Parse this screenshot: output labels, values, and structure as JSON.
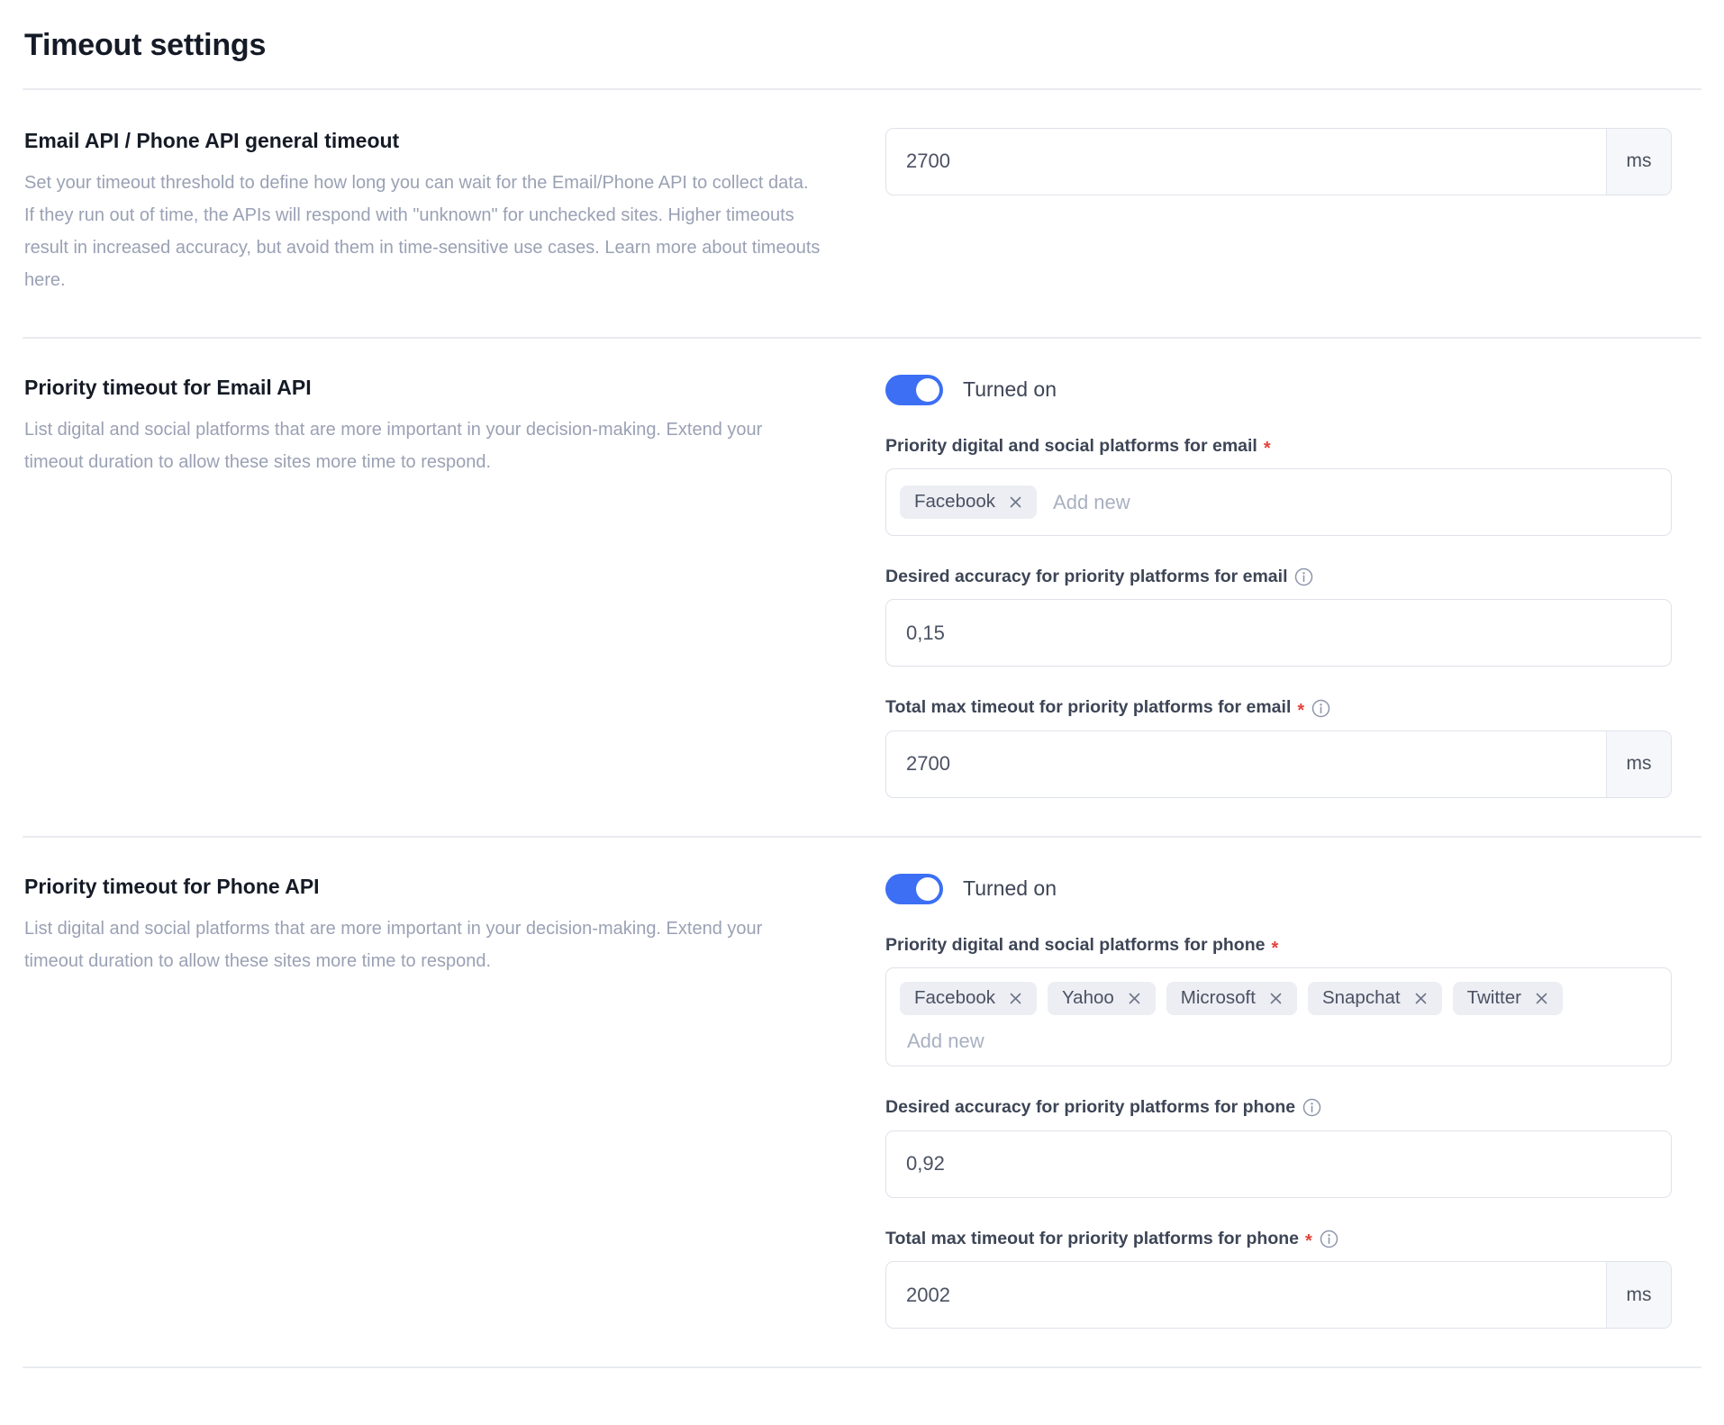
{
  "page": {
    "title": "Timeout settings"
  },
  "colors": {
    "toggle_on": "#3c6ff4",
    "required_star": "#e3443a",
    "text_primary": "#151b26",
    "text_muted": "#9aa1b4",
    "border": "#dfe2ea",
    "tag_bg": "#eceef3"
  },
  "sections": {
    "general": {
      "heading": "Email API / Phone API general timeout",
      "description": "Set your timeout threshold to define how long you can wait for the Email/Phone API to collect data. If they run out of time, the APIs will respond with \"unknown\" for unchecked sites. Higher timeouts result in increased accuracy, but avoid them in time-sensitive use cases. Learn more about timeouts here.",
      "timeout_value": "2700",
      "timeout_unit": "ms"
    },
    "email": {
      "heading": "Priority timeout for Email API",
      "description": "List digital and social platforms that are more important in your decision-making. Extend your timeout duration to allow these sites more time to respond.",
      "toggle_label": "Turned on",
      "toggle_state": "on",
      "platforms_label": "Priority digital and social platforms for email",
      "platforms_required": "*",
      "platforms": [
        "Facebook"
      ],
      "add_new_placeholder": "Add new",
      "accuracy_label": "Desired accuracy for priority platforms for email",
      "accuracy_value": "0,15",
      "max_timeout_label": "Total max timeout for priority platforms for email",
      "max_timeout_required": "*",
      "max_timeout_value": "2700",
      "max_timeout_unit": "ms"
    },
    "phone": {
      "heading": "Priority timeout for Phone API",
      "description": "List digital and social platforms that are more important in your decision-making. Extend your timeout duration to allow these sites more time to respond.",
      "toggle_label": "Turned on",
      "toggle_state": "on",
      "platforms_label": "Priority digital and social platforms for phone",
      "platforms_required": "*",
      "platforms": [
        "Facebook",
        "Yahoo",
        "Microsoft",
        "Snapchat",
        "Twitter"
      ],
      "add_new_placeholder": "Add new",
      "accuracy_label": "Desired accuracy for priority platforms for phone",
      "accuracy_value": "0,92",
      "max_timeout_label": "Total max timeout for priority platforms for phone",
      "max_timeout_required": "*",
      "max_timeout_value": "2002",
      "max_timeout_unit": "ms"
    }
  },
  "icons": {
    "info": "info-circle-icon",
    "remove_tag": "close-icon"
  }
}
